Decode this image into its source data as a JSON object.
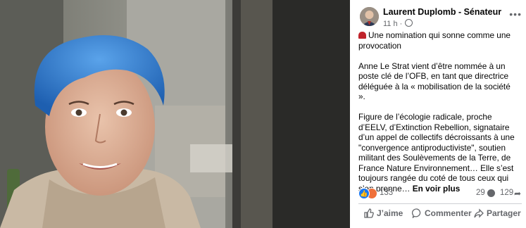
{
  "post": {
    "author": "Laurent Duplomb - Sénateur",
    "time": "11 h ·",
    "more_icon": "more-dots-icon",
    "paragraphs": [
      "Une nomination qui sonne comme une provocation",
      "Anne Le Strat vient d’être nommée à un poste clé de l’OFB, en tant que directrice déléguée à la « mobilisation de la société ».",
      "Figure de l’écologie radicale, proche d’EELV, d’Extinction Rebellion, signataire d’un appel de collectifs décroissants à une \"convergence antiproductiviste\", soutien militant des Soulèvements de la Terre, de France Nature Environnement… Elle s’est toujours rangée du coté de tous ceux qui s’en prenne…"
    ],
    "see_more": "En voir plus"
  },
  "stats": {
    "reactions": "133",
    "comments": "29",
    "shares": "129"
  },
  "actions": {
    "like": "J’aime",
    "comment": "Commenter",
    "share": "Partager"
  },
  "colors": {
    "accent": "#1877f2",
    "hair": "#2f7fd6",
    "siren": "#c0232b"
  }
}
